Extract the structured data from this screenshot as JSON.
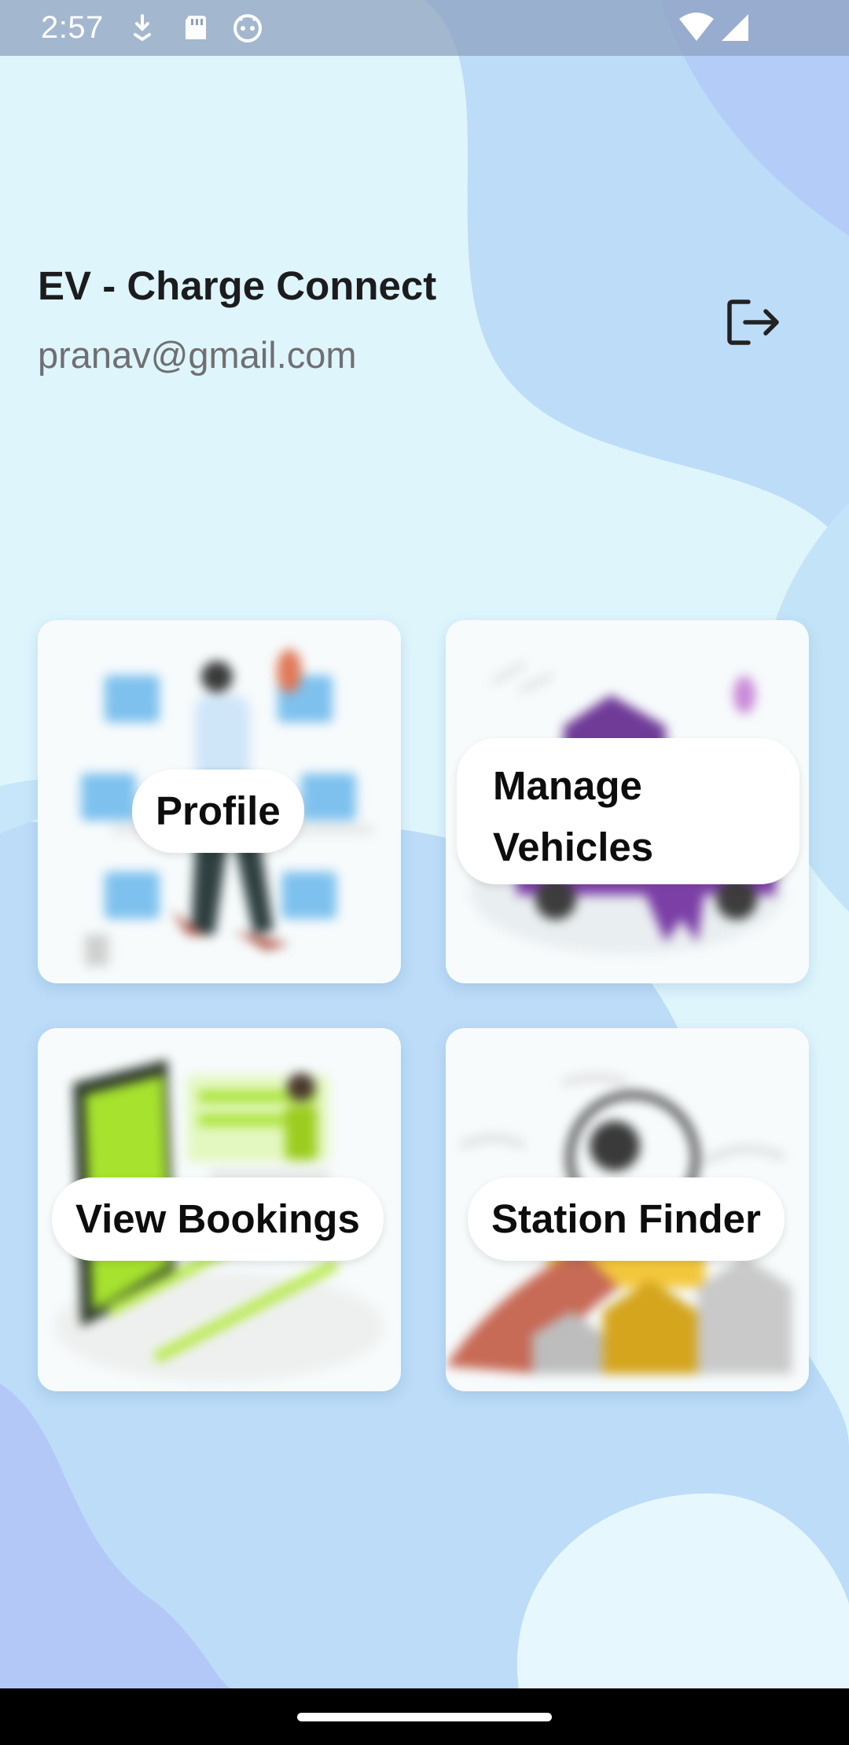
{
  "status_bar": {
    "time": "2:57",
    "icons": [
      "download-icon",
      "sd-card-icon",
      "android-debug-icon",
      "wifi-icon",
      "cellular-signal-icon"
    ]
  },
  "header": {
    "title": "EV - Charge Connect",
    "email": "pranav@gmail.com",
    "logout_icon": "logout-icon"
  },
  "cards": {
    "profile": {
      "label": "Profile",
      "illustration": "profile-illustration"
    },
    "vehicles": {
      "label_line1": "Manage",
      "label_line2": "Vehicles",
      "illustration": "vehicles-illustration"
    },
    "bookings": {
      "label": "View Bookings",
      "illustration": "bookings-illustration"
    },
    "finder": {
      "label": "Station Finder",
      "illustration": "station-finder-illustration"
    }
  },
  "colors": {
    "background_light": "#d8f1fb",
    "background_blob": "#b7d9f6",
    "text_primary": "#1c1c1e",
    "text_secondary": "#6f6f72",
    "card_bg": "#f7fbfc",
    "accent_purple": "#7b3fa6",
    "accent_lime": "#a6e22e",
    "accent_blue": "#6fb8ec",
    "accent_yellow": "#f3c73c"
  }
}
